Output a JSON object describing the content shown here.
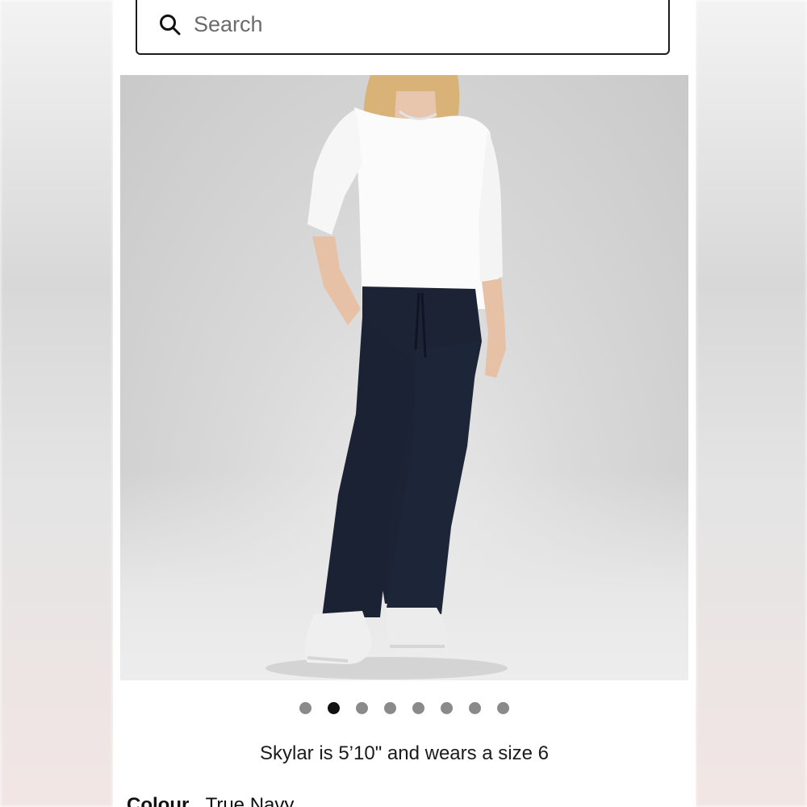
{
  "search": {
    "placeholder": "Search"
  },
  "product": {
    "carousel": {
      "count": 8,
      "active_index": 1
    },
    "model_note": "Skylar is 5’10\" and wears a size 6",
    "colour_label": "Colour",
    "colour_value": "True Navy"
  },
  "colors": {
    "tee": "#ffffff",
    "pants": "#1a2236",
    "background": "#d4d4d4",
    "dot_active": "#111111",
    "dot_inactive": "#8a8a8a"
  }
}
